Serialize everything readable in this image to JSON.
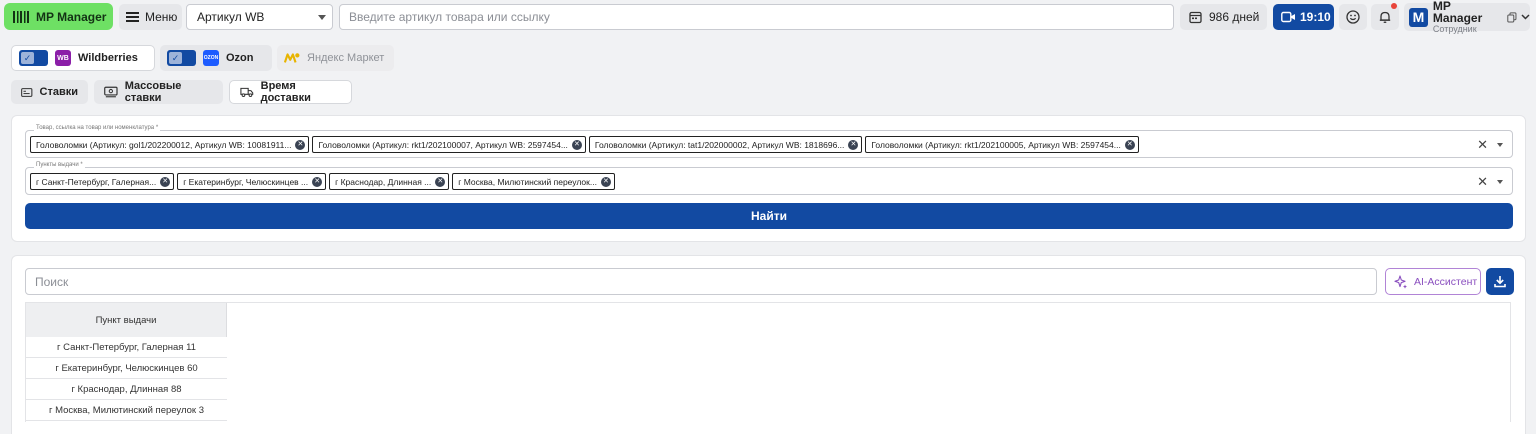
{
  "header": {
    "logo_label": "MP Manager",
    "menu_label": "Меню",
    "article_select": "Артикул WB",
    "search_placeholder": "Введите артикул товара или ссылку",
    "days_label": "986 дней",
    "time_label": "19:10",
    "user": {
      "name": "MP Manager",
      "role": "Сотрудник",
      "avatar_letter": "M"
    }
  },
  "marketplaces": [
    {
      "label": "Wildberries",
      "logo": "WB",
      "enabled": true
    },
    {
      "label": "Ozon",
      "logo": "OZON",
      "enabled": true
    },
    {
      "label": "Яндекс Маркет",
      "enabled": false
    }
  ],
  "tools": [
    {
      "label": "Ставки"
    },
    {
      "label": "Массовые ставки"
    },
    {
      "label": "Время доставки"
    }
  ],
  "filters": {
    "products_label": "Товар, ссылка на товар или номенклатура *",
    "products": [
      "Головоломки (Артикул: gol1/202200012, Артикул WB: 10081911...",
      "Головоломки (Артикул: rkt1/202100007, Артикул WB: 2597454...",
      "Головоломки (Артикул: tat1/202000002, Артикул WB: 1818696...",
      "Головоломки (Артикул: rkt1/202100005, Артикул WB: 2597454..."
    ],
    "points_label": "Пункты выдачи *",
    "points": [
      "г Санкт-Петербург, Галерная...",
      "г Екатеринбург, Челюскинцев ...",
      "г Краснодар, Длинная ...",
      "г Москва, Милютинский переулок..."
    ],
    "clear_symbol": "✕",
    "find_label": "Найти"
  },
  "results": {
    "search_placeholder": "Поиск",
    "ai_label": "AI-Ассистент",
    "column_header": "Пункт выдачи",
    "rows": [
      "г Санкт-Петербург, Галерная 11",
      "г Екатеринбург, Челюскинцев 60",
      "г Краснодар, Длинная 88",
      "г Москва, Милютинский переулок 3"
    ]
  },
  "colors": {
    "primary": "#124aa2",
    "logo_green": "#6ee064",
    "wb_purple": "#8b1ea8",
    "ozon_blue": "#1d5cff",
    "ai_purple": "#8a4fbf"
  }
}
